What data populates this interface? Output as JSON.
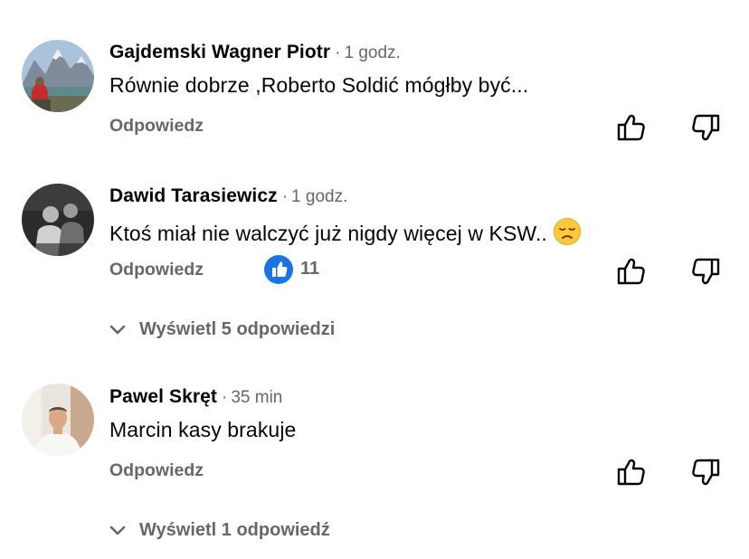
{
  "comments": [
    {
      "author": "Gajdemski Wagner Piotr",
      "time": "1 godz.",
      "text": "Równie dobrze ,Roberto Soldić mógłby być...",
      "reply_label": "Odpowiedz",
      "avatar_icon": "mountain-lake-photo"
    },
    {
      "author": "Dawid Tarasiewicz",
      "time": "1 godz.",
      "text": "Ktoś miał nie walczyć już nigdy więcej w KSW..",
      "emoji": "disappointed-face-emoji",
      "reply_label": "Odpowiedz",
      "like_count": "11",
      "view_replies": "Wyświetl 5 odpowiedzi",
      "avatar_icon": "fighters-photo"
    },
    {
      "author": "Pawel Skręt",
      "time": "35 min",
      "text": "Marcin kasy brakuje",
      "reply_label": "Odpowiedz",
      "view_replies": "Wyświetl 1 odpowiedź",
      "avatar_icon": "person-photo"
    }
  ],
  "separator": "·",
  "colors": {
    "text_primary": "#050505",
    "text_secondary": "#65676b",
    "like_blue": "#1b74e4"
  },
  "icons": [
    "thumbs-up-outline-icon",
    "thumbs-down-outline-icon",
    "like-badge-icon",
    "chevron-down-icon"
  ]
}
